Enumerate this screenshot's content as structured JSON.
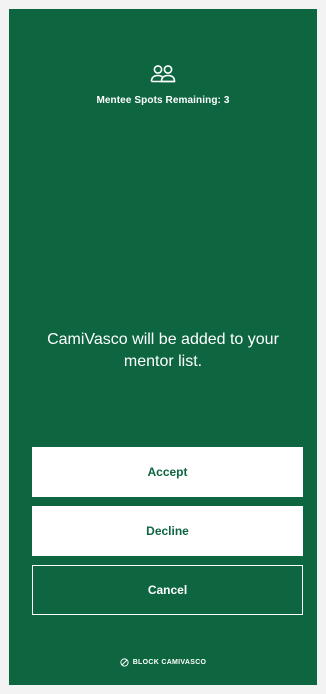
{
  "header": {
    "icon": "people-icon",
    "spots_label": "Mentee Spots Remaining: 3"
  },
  "message": "CamiVasco will be added to your mentor list.",
  "actions": {
    "accept_label": "Accept",
    "decline_label": "Decline",
    "cancel_label": "Cancel"
  },
  "block": {
    "icon": "block-icon",
    "label": "BLOCK CAMIVASCO"
  },
  "colors": {
    "background": "#0e6641",
    "button_fill": "#ffffff",
    "text_light": "#ffffff"
  }
}
